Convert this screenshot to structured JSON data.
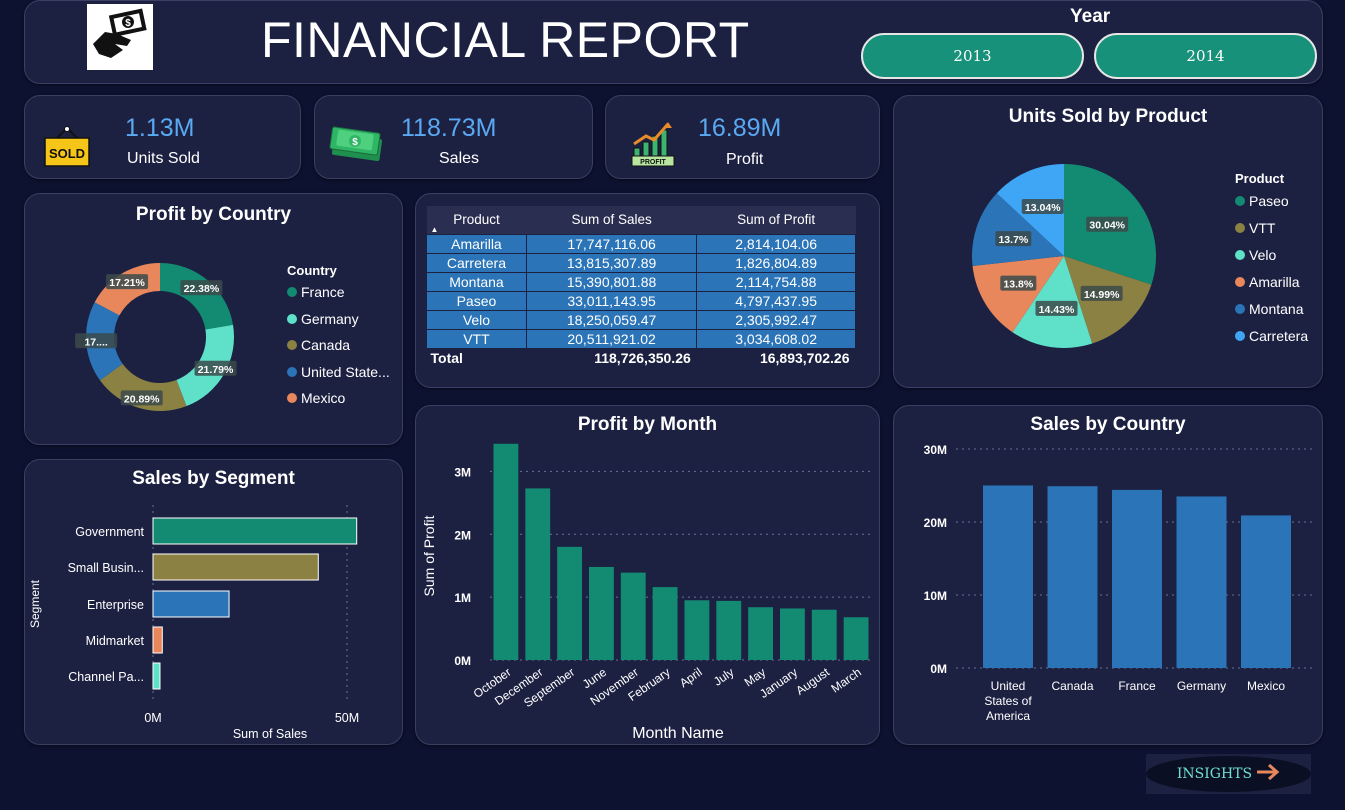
{
  "header": {
    "title": "FINANCIAL REPORT",
    "year_label": "Year",
    "years": [
      "2013",
      "2014"
    ]
  },
  "kpis": [
    {
      "value": "1.13M",
      "label": "Units Sold",
      "icon": "sold-sign-icon"
    },
    {
      "value": "118.73M",
      "label": "Sales",
      "icon": "money-stack-icon"
    },
    {
      "value": "16.89M",
      "label": "Profit",
      "icon": "profit-chart-icon"
    }
  ],
  "colors": {
    "teal": "#138a72",
    "olive": "#8a8142",
    "mint": "#5fe0c8",
    "steelblue": "#2b74b8",
    "salmon": "#e8875c",
    "lightblue": "#3fa5f5",
    "card": "#1c2142",
    "background": "#0d1230",
    "kpi_value": "#5aa9f2"
  },
  "profit_by_country": {
    "title": "Profit by Country",
    "legend_title": "Country",
    "legend": [
      "France",
      "Germany",
      "Canada",
      "United State...",
      "Mexico"
    ],
    "labels": [
      "22.38%",
      "21.79%",
      "20.89%",
      "17....",
      "17.21%"
    ]
  },
  "table": {
    "headers": [
      "Product",
      "Sum of Sales",
      "Sum of Profit"
    ],
    "rows": [
      [
        "Amarilla",
        "17,747,116.06",
        "2,814,104.06"
      ],
      [
        "Carretera",
        "13,815,307.89",
        "1,826,804.89"
      ],
      [
        "Montana",
        "15,390,801.88",
        "2,114,754.88"
      ],
      [
        "Paseo",
        "33,011,143.95",
        "4,797,437.95"
      ],
      [
        "Velo",
        "18,250,059.47",
        "2,305,992.47"
      ],
      [
        "VTT",
        "20,511,921.02",
        "3,034,608.02"
      ]
    ],
    "total": [
      "Total",
      "118,726,350.26",
      "16,893,702.26"
    ]
  },
  "units_by_product": {
    "title": "Units Sold by Product",
    "legend_title": "Product",
    "legend": [
      "Paseo",
      "VTT",
      "Velo",
      "Amarilla",
      "Montana",
      "Carretera"
    ],
    "labels": [
      "30.04%",
      "14.99%",
      "14.43%",
      "13.8%",
      "13.7%",
      "13.04%"
    ]
  },
  "sales_by_segment": {
    "title": "Sales by Segment",
    "ylabel": "Segment",
    "xlabel": "Sum of Sales",
    "categories": [
      "Government",
      "Small Busin...",
      "Enterprise",
      "Midmarket",
      "Channel Pa..."
    ],
    "xticks": [
      "0M",
      "50M"
    ]
  },
  "profit_by_month": {
    "title": "Profit by Month",
    "ylabel": "Sum of Profit",
    "xlabel": "Month Name",
    "categories": [
      "October",
      "December",
      "September",
      "June",
      "November",
      "February",
      "April",
      "July",
      "May",
      "January",
      "August",
      "March"
    ],
    "yticks": [
      "0M",
      "1M",
      "2M",
      "3M"
    ]
  },
  "sales_by_country": {
    "title": "Sales by Country",
    "categories": [
      "United States of America",
      "Canada",
      "France",
      "Germany",
      "Mexico"
    ],
    "yticks": [
      "0M",
      "10M",
      "20M",
      "30M"
    ]
  },
  "chart_data": [
    {
      "type": "pie",
      "title": "Profit by Country",
      "categories": [
        "France",
        "Germany",
        "Canada",
        "United States of America",
        "Mexico"
      ],
      "values": [
        22.38,
        21.79,
        20.89,
        17.72,
        17.21
      ]
    },
    {
      "type": "pie",
      "title": "Units Sold by Product",
      "categories": [
        "Paseo",
        "VTT",
        "Velo",
        "Amarilla",
        "Montana",
        "Carretera"
      ],
      "values": [
        30.04,
        14.99,
        14.43,
        13.8,
        13.7,
        13.04
      ]
    },
    {
      "type": "bar",
      "title": "Sales by Segment",
      "orientation": "horizontal",
      "categories": [
        "Government",
        "Small Business",
        "Enterprise",
        "Midmarket",
        "Channel Partners"
      ],
      "values": [
        52.5,
        42.6,
        19.6,
        2.4,
        1.8
      ],
      "unit": "M",
      "xlabel": "Sum of Sales",
      "ylabel": "Segment",
      "xlim": [
        0,
        60
      ]
    },
    {
      "type": "bar",
      "title": "Profit by Month",
      "categories": [
        "October",
        "December",
        "September",
        "June",
        "November",
        "February",
        "April",
        "July",
        "May",
        "January",
        "August",
        "March"
      ],
      "values": [
        3.44,
        2.73,
        1.8,
        1.48,
        1.39,
        1.16,
        0.95,
        0.94,
        0.84,
        0.82,
        0.8,
        0.68
      ],
      "unit": "M",
      "xlabel": "Month Name",
      "ylabel": "Sum of Profit",
      "ylim": [
        0,
        3.5
      ]
    },
    {
      "type": "bar",
      "title": "Sales by Country",
      "categories": [
        "United States of America",
        "Canada",
        "France",
        "Germany",
        "Mexico"
      ],
      "values": [
        25.0,
        24.9,
        24.4,
        23.5,
        20.9
      ],
      "unit": "M",
      "ylim": [
        0,
        30
      ]
    }
  ],
  "insights_button": "INSIGHTS"
}
